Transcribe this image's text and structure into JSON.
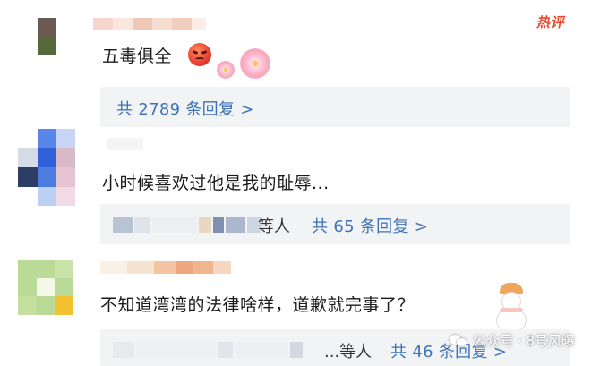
{
  "hot_badge": "热评",
  "comments": [
    {
      "text": "五毒俱全",
      "reply_link": "共 2789 条回复 >"
    },
    {
      "text": "小时候喜欢过他是我的耻辱...",
      "reply_names_suffix": "等人",
      "reply_link": "共 65 条回复 >"
    },
    {
      "text": "不知道湾湾的法律啥样，道歉就完事了？",
      "reply_names_suffix": "...等人",
      "reply_link": "共 46 条回复 >"
    }
  ],
  "watermark": {
    "text": "公众号 · 8号风曝"
  },
  "icons": {
    "angry_emoji": "angry-face-icon",
    "flower_sticker": "cherry-blossom-icon",
    "snowman_sticker": "snowman-icon",
    "watermark_logo": "wechat-icon"
  },
  "colors": {
    "link": "#3d72b8",
    "hot": "#e8492f",
    "reply_bg": "#f2f3f5"
  }
}
